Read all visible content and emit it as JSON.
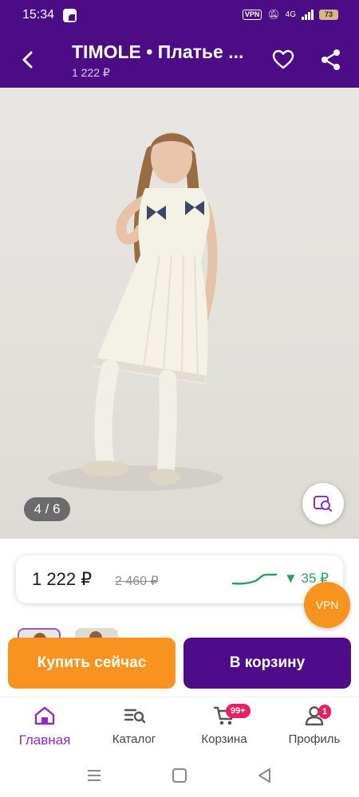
{
  "status_bar": {
    "time": "15:34",
    "vpn": "VPN",
    "network": "4G",
    "battery": "73"
  },
  "app_bar": {
    "title": "TIMOLE • Платье ...",
    "price": "1 222 ₽"
  },
  "gallery": {
    "counter": "4 / 6"
  },
  "price_card": {
    "current": "1 222 ₽",
    "old": "2 460 ₽",
    "delta": "▼ 35 ₽",
    "delta_color": "#29a35a"
  },
  "vpn_fab": {
    "label": "VPN"
  },
  "actions": {
    "buy_now": "Купить сейчас",
    "to_cart": "В корзину"
  },
  "bottom_nav": {
    "items": [
      {
        "label": "Главная",
        "icon": "home-icon",
        "active": true
      },
      {
        "label": "Каталог",
        "icon": "catalog-search-icon"
      },
      {
        "label": "Корзина",
        "icon": "cart-icon",
        "badge": "99+"
      },
      {
        "label": "Профиль",
        "icon": "profile-icon",
        "badge": "1"
      }
    ]
  },
  "colors": {
    "brand_purple": "#4b0c86",
    "accent_orange": "#f7931e",
    "active_nav": "#8a2cc4",
    "badge": "#ea1e63"
  }
}
